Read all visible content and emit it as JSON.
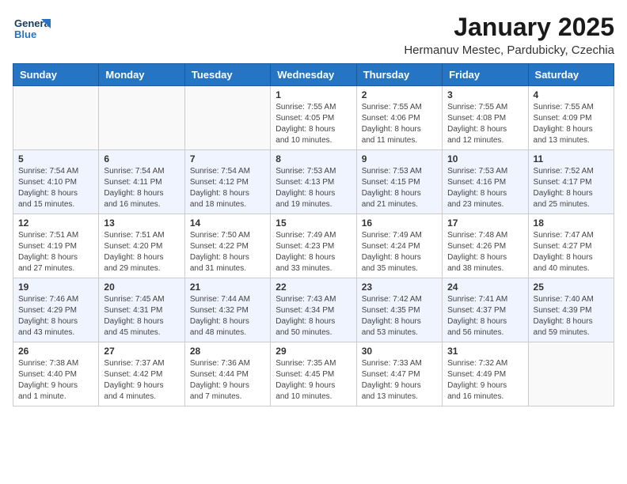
{
  "app": {
    "logo_general": "General",
    "logo_blue": "Blue",
    "title": "January 2025",
    "subtitle": "Hermanuv Mestec, Pardubicky, Czechia"
  },
  "calendar": {
    "headers": [
      "Sunday",
      "Monday",
      "Tuesday",
      "Wednesday",
      "Thursday",
      "Friday",
      "Saturday"
    ],
    "rows": [
      [
        {
          "day": "",
          "info": ""
        },
        {
          "day": "",
          "info": ""
        },
        {
          "day": "",
          "info": ""
        },
        {
          "day": "1",
          "info": "Sunrise: 7:55 AM\nSunset: 4:05 PM\nDaylight: 8 hours\nand 10 minutes."
        },
        {
          "day": "2",
          "info": "Sunrise: 7:55 AM\nSunset: 4:06 PM\nDaylight: 8 hours\nand 11 minutes."
        },
        {
          "day": "3",
          "info": "Sunrise: 7:55 AM\nSunset: 4:08 PM\nDaylight: 8 hours\nand 12 minutes."
        },
        {
          "day": "4",
          "info": "Sunrise: 7:55 AM\nSunset: 4:09 PM\nDaylight: 8 hours\nand 13 minutes."
        }
      ],
      [
        {
          "day": "5",
          "info": "Sunrise: 7:54 AM\nSunset: 4:10 PM\nDaylight: 8 hours\nand 15 minutes."
        },
        {
          "day": "6",
          "info": "Sunrise: 7:54 AM\nSunset: 4:11 PM\nDaylight: 8 hours\nand 16 minutes."
        },
        {
          "day": "7",
          "info": "Sunrise: 7:54 AM\nSunset: 4:12 PM\nDaylight: 8 hours\nand 18 minutes."
        },
        {
          "day": "8",
          "info": "Sunrise: 7:53 AM\nSunset: 4:13 PM\nDaylight: 8 hours\nand 19 minutes."
        },
        {
          "day": "9",
          "info": "Sunrise: 7:53 AM\nSunset: 4:15 PM\nDaylight: 8 hours\nand 21 minutes."
        },
        {
          "day": "10",
          "info": "Sunrise: 7:53 AM\nSunset: 4:16 PM\nDaylight: 8 hours\nand 23 minutes."
        },
        {
          "day": "11",
          "info": "Sunrise: 7:52 AM\nSunset: 4:17 PM\nDaylight: 8 hours\nand 25 minutes."
        }
      ],
      [
        {
          "day": "12",
          "info": "Sunrise: 7:51 AM\nSunset: 4:19 PM\nDaylight: 8 hours\nand 27 minutes."
        },
        {
          "day": "13",
          "info": "Sunrise: 7:51 AM\nSunset: 4:20 PM\nDaylight: 8 hours\nand 29 minutes."
        },
        {
          "day": "14",
          "info": "Sunrise: 7:50 AM\nSunset: 4:22 PM\nDaylight: 8 hours\nand 31 minutes."
        },
        {
          "day": "15",
          "info": "Sunrise: 7:49 AM\nSunset: 4:23 PM\nDaylight: 8 hours\nand 33 minutes."
        },
        {
          "day": "16",
          "info": "Sunrise: 7:49 AM\nSunset: 4:24 PM\nDaylight: 8 hours\nand 35 minutes."
        },
        {
          "day": "17",
          "info": "Sunrise: 7:48 AM\nSunset: 4:26 PM\nDaylight: 8 hours\nand 38 minutes."
        },
        {
          "day": "18",
          "info": "Sunrise: 7:47 AM\nSunset: 4:27 PM\nDaylight: 8 hours\nand 40 minutes."
        }
      ],
      [
        {
          "day": "19",
          "info": "Sunrise: 7:46 AM\nSunset: 4:29 PM\nDaylight: 8 hours\nand 43 minutes."
        },
        {
          "day": "20",
          "info": "Sunrise: 7:45 AM\nSunset: 4:31 PM\nDaylight: 8 hours\nand 45 minutes."
        },
        {
          "day": "21",
          "info": "Sunrise: 7:44 AM\nSunset: 4:32 PM\nDaylight: 8 hours\nand 48 minutes."
        },
        {
          "day": "22",
          "info": "Sunrise: 7:43 AM\nSunset: 4:34 PM\nDaylight: 8 hours\nand 50 minutes."
        },
        {
          "day": "23",
          "info": "Sunrise: 7:42 AM\nSunset: 4:35 PM\nDaylight: 8 hours\nand 53 minutes."
        },
        {
          "day": "24",
          "info": "Sunrise: 7:41 AM\nSunset: 4:37 PM\nDaylight: 8 hours\nand 56 minutes."
        },
        {
          "day": "25",
          "info": "Sunrise: 7:40 AM\nSunset: 4:39 PM\nDaylight: 8 hours\nand 59 minutes."
        }
      ],
      [
        {
          "day": "26",
          "info": "Sunrise: 7:38 AM\nSunset: 4:40 PM\nDaylight: 9 hours\nand 1 minute."
        },
        {
          "day": "27",
          "info": "Sunrise: 7:37 AM\nSunset: 4:42 PM\nDaylight: 9 hours\nand 4 minutes."
        },
        {
          "day": "28",
          "info": "Sunrise: 7:36 AM\nSunset: 4:44 PM\nDaylight: 9 hours\nand 7 minutes."
        },
        {
          "day": "29",
          "info": "Sunrise: 7:35 AM\nSunset: 4:45 PM\nDaylight: 9 hours\nand 10 minutes."
        },
        {
          "day": "30",
          "info": "Sunrise: 7:33 AM\nSunset: 4:47 PM\nDaylight: 9 hours\nand 13 minutes."
        },
        {
          "day": "31",
          "info": "Sunrise: 7:32 AM\nSunset: 4:49 PM\nDaylight: 9 hours\nand 16 minutes."
        },
        {
          "day": "",
          "info": ""
        }
      ]
    ]
  }
}
